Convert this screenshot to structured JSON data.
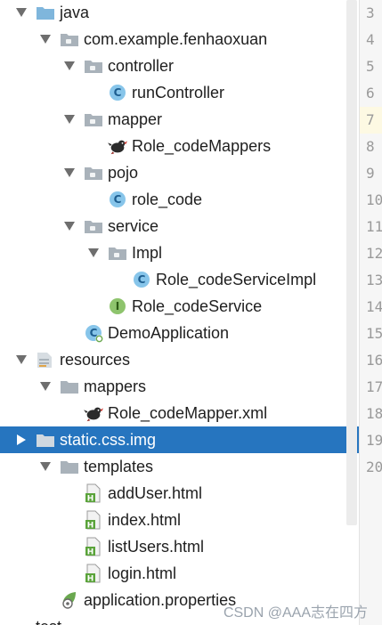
{
  "tree": {
    "items": [
      {
        "label": "java",
        "icon": "folder-blue-icon",
        "arrow": "down",
        "depth": 0,
        "partial": true
      },
      {
        "label": "com.example.fenhaoxuan",
        "icon": "package-icon",
        "arrow": "down",
        "depth": 1
      },
      {
        "label": "controller",
        "icon": "package-icon",
        "arrow": "down",
        "depth": 2
      },
      {
        "label": "runController",
        "icon": "class-icon",
        "arrow": "none",
        "depth": 3
      },
      {
        "label": "mapper",
        "icon": "package-icon",
        "arrow": "down",
        "depth": 2
      },
      {
        "label": "Role_codeMappers",
        "icon": "mybatis-bird-icon",
        "arrow": "none",
        "depth": 3
      },
      {
        "label": "pojo",
        "icon": "package-icon",
        "arrow": "down",
        "depth": 2
      },
      {
        "label": "role_code",
        "icon": "class-icon",
        "arrow": "none",
        "depth": 3
      },
      {
        "label": "service",
        "icon": "package-icon",
        "arrow": "down",
        "depth": 2
      },
      {
        "label": "Impl",
        "icon": "package-icon",
        "arrow": "down",
        "depth": 3
      },
      {
        "label": "Role_codeServiceImpl",
        "icon": "class-icon",
        "arrow": "none",
        "depth": 4
      },
      {
        "label": "Role_codeService",
        "icon": "interface-icon",
        "arrow": "none",
        "depth": 3
      },
      {
        "label": "DemoApplication",
        "icon": "spring-class-icon",
        "arrow": "none",
        "depth": 2
      },
      {
        "label": "resources",
        "icon": "resources-folder-icon",
        "arrow": "down",
        "depth": 0
      },
      {
        "label": "mappers",
        "icon": "folder-gray-icon",
        "arrow": "down",
        "depth": 1
      },
      {
        "label": "Role_codeMapper.xml",
        "icon": "mybatis-bird-icon",
        "arrow": "none",
        "depth": 2
      },
      {
        "label": "static.css.img",
        "icon": "folder-gray-icon",
        "arrow": "right",
        "depth": 0,
        "selected": true
      },
      {
        "label": "templates",
        "icon": "folder-gray-icon",
        "arrow": "down",
        "depth": 1
      },
      {
        "label": "addUser.html",
        "icon": "html-file-icon",
        "arrow": "none",
        "depth": 2
      },
      {
        "label": "index.html",
        "icon": "html-file-icon",
        "arrow": "none",
        "depth": 2
      },
      {
        "label": "listUsers.html",
        "icon": "html-file-icon",
        "arrow": "none",
        "depth": 2
      },
      {
        "label": "login.html",
        "icon": "html-file-icon",
        "arrow": "none",
        "depth": 2
      },
      {
        "label": "application.properties",
        "icon": "spring-properties-icon",
        "arrow": "none",
        "depth": 1
      },
      {
        "label": "test",
        "icon": "none",
        "arrow": "none",
        "depth": 0,
        "partial": true
      }
    ]
  },
  "gutter": {
    "lines": [
      "3",
      "4",
      "5",
      "6",
      "7",
      "8",
      "9",
      "10",
      "11",
      "12",
      "13",
      "14",
      "15",
      "16",
      "17",
      "18",
      "19",
      "20"
    ],
    "current_line": "7"
  },
  "watermark": "CSDN @AAA志在四方",
  "colors": {
    "selection": "#2675bf",
    "class_icon": "#87c5ea",
    "interface_icon": "#8ec46d",
    "folder_blue": "#7fb6dc",
    "folder_gray": "#a9b2ba"
  }
}
